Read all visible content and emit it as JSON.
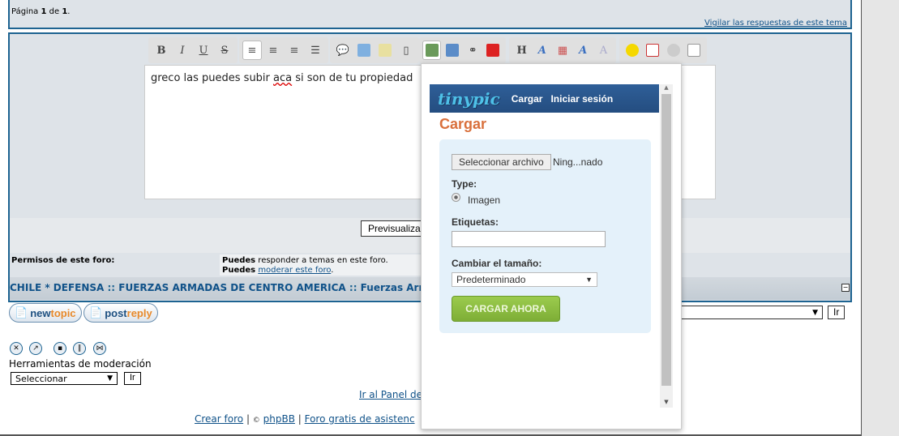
{
  "pagination": {
    "prefix": "Página ",
    "current": "1",
    "mid": " de ",
    "total": "1",
    "suffix": "."
  },
  "watch_link": "Vigilar las respuestas de este tema",
  "editor": {
    "text": "greco las puedes subir ",
    "misspelled": "aca",
    "text2": " si son de tu propiedad",
    "toolbar": [
      "bold",
      "italic",
      "underline",
      "strike",
      "align-left",
      "align-center",
      "align-right",
      "justify",
      "quote",
      "code",
      "spoiler",
      "hide",
      "image-host",
      "image",
      "link",
      "youtube",
      "heading",
      "font-size",
      "color",
      "font",
      "remove-format",
      "emoticons",
      "date",
      "time",
      "page"
    ],
    "labels": {
      "bold": "B",
      "italic": "I",
      "underline": "U",
      "strike": "S",
      "heading": "H"
    }
  },
  "preview_button": "Previsualiza",
  "permissions": {
    "label": "Permisos de este foro:",
    "line1_bold": "Puedes",
    "line1": " responder a temas en este foro.",
    "line2_bold": "Puedes",
    "line2_link": "moderar este foro",
    "line2_end": "."
  },
  "breadcrumb": {
    "a": "CHILE * DEFENSA",
    "sep": " :: ",
    "b": "FUERZAS ARMADAS DE CENTRO AMERICA",
    "c": "Fuerzas Armadas"
  },
  "buttons": {
    "newtopic_a": "new",
    "newtopic_b": "topic",
    "postreply_a": "post",
    "postreply_b": "reply"
  },
  "mod_icons": [
    "delete",
    "move",
    "lock",
    "split",
    "merge"
  ],
  "mod": {
    "label": "Herramientas de moderación",
    "select": "Seleccionar",
    "go": "Ir"
  },
  "jump": {
    "go": "Ir"
  },
  "panel_link": "Ir al Panel de",
  "footer": {
    "create": "Crear foro",
    "sep": " | ",
    "copy": "©",
    "phpbb": "phpBB",
    "free": "Foro gratis de asistenc"
  },
  "tinypic": {
    "logo": "tinypic",
    "nav": [
      "Cargar",
      "Iniciar sesión"
    ],
    "title": "Cargar",
    "file_button": "Seleccionar archivo",
    "file_status": "Ning...nado",
    "type_label": "Type:",
    "type_option": "Imagen",
    "tags_label": "Etiquetas:",
    "tags_value": "",
    "resize_label": "Cambiar el tamaño:",
    "resize_value": "Predeterminado",
    "submit": "CARGAR AHORA"
  },
  "colors": {
    "border": "#1d6391",
    "panel": "#dee3e8",
    "tinypic_header": "#2f5f98",
    "cargar_title": "#d9703c",
    "submit_green": "#8cbf3f"
  }
}
